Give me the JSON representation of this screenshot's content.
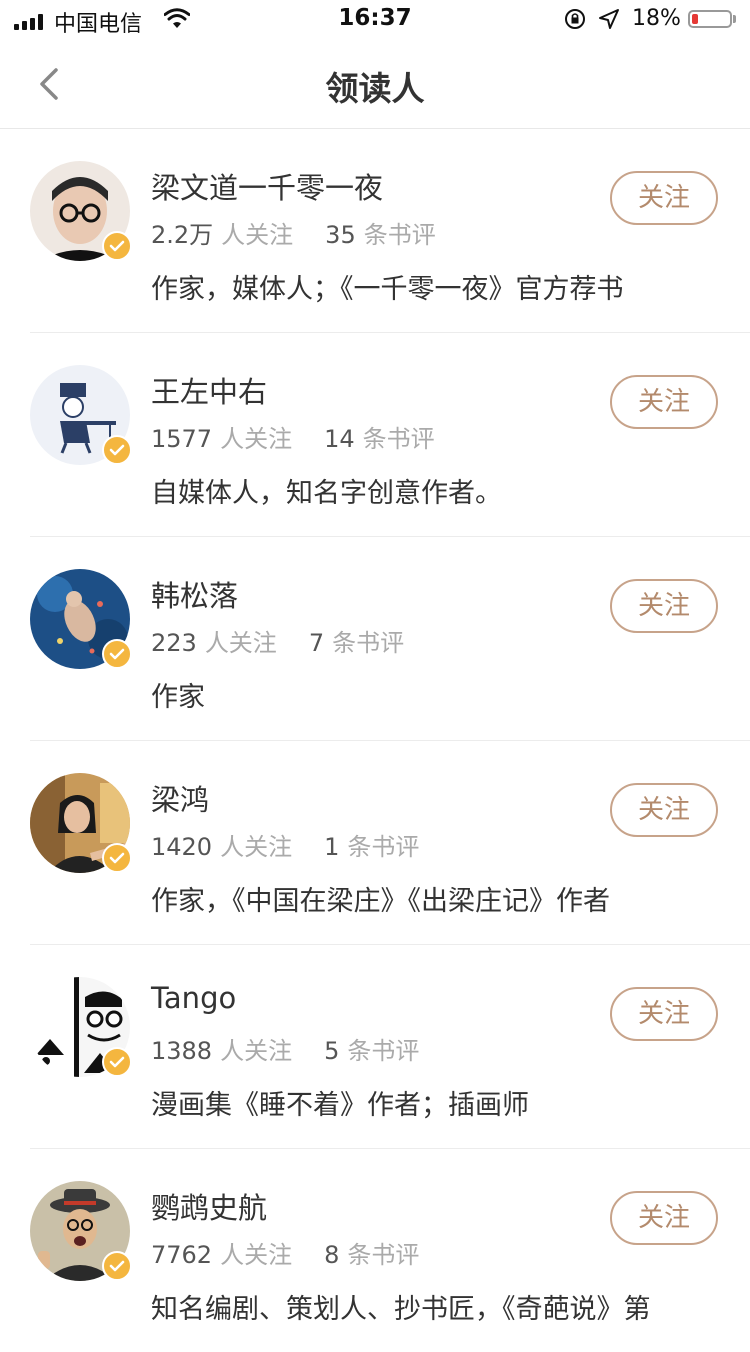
{
  "status_bar": {
    "carrier": "中国电信",
    "time": "16:37",
    "battery_percent": "18%",
    "battery_level": 0.18,
    "battery_color": "#e53935"
  },
  "nav": {
    "title": "领读人",
    "back_icon": "chevron-left-icon"
  },
  "colors": {
    "accent": "#c7a38a",
    "verified": "#f4b63f"
  },
  "readers": [
    {
      "name": "梁文道一千零一夜",
      "followers": "2.2万",
      "followers_label": "人关注",
      "reviews": "35",
      "reviews_label": "条书评",
      "description": "作家，媒体人；《一千零一夜》官方荐书",
      "follow_label": "关注"
    },
    {
      "name": "王左中右",
      "followers": "1577",
      "followers_label": "人关注",
      "reviews": "14",
      "reviews_label": "条书评",
      "description": "自媒体人，知名字创意作者。",
      "follow_label": "关注"
    },
    {
      "name": "韩松落",
      "followers": "223",
      "followers_label": "人关注",
      "reviews": "7",
      "reviews_label": "条书评",
      "description": "作家",
      "follow_label": "关注"
    },
    {
      "name": "梁鸿",
      "followers": "1420",
      "followers_label": "人关注",
      "reviews": "1",
      "reviews_label": "条书评",
      "description": "作家，《中国在梁庄》《出梁庄记》作者",
      "follow_label": "关注"
    },
    {
      "name": "Tango",
      "followers": "1388",
      "followers_label": "人关注",
      "reviews": "5",
      "reviews_label": "条书评",
      "description": "漫画集《睡不着》作者；插画师",
      "follow_label": "关注"
    },
    {
      "name": "鹦鹉史航",
      "followers": "7762",
      "followers_label": "人关注",
      "reviews": "8",
      "reviews_label": "条书评",
      "description": "知名编剧、策划人、抄书匠，《奇葩说》第",
      "follow_label": "关注"
    }
  ]
}
